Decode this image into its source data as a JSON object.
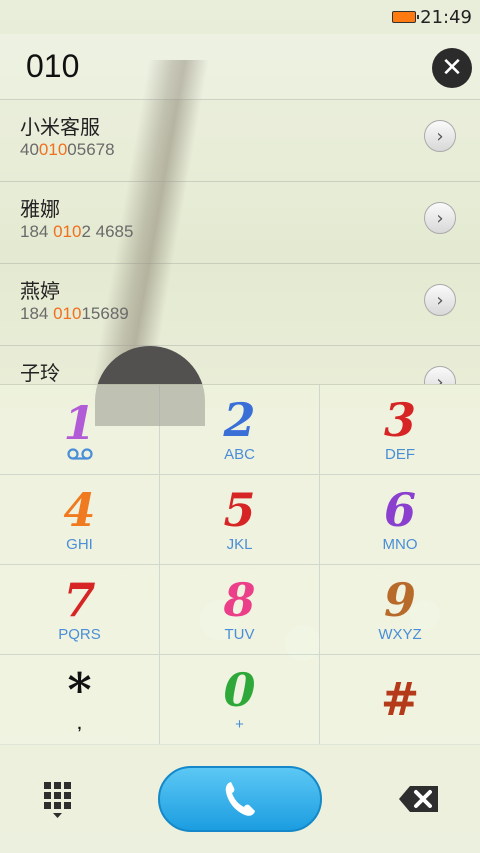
{
  "status_bar": {
    "time": "21:49"
  },
  "dialer": {
    "input": "010"
  },
  "results": [
    {
      "name": "小米客服",
      "number_pre": "40",
      "number_match": "010",
      "number_post": "05678"
    },
    {
      "name": "雅娜",
      "number_pre": "184 ",
      "number_match": "010",
      "number_post": "2 4685"
    },
    {
      "name": "燕婷",
      "number_pre": "184 ",
      "number_match": "010",
      "number_post": "15689"
    },
    {
      "name": "子玲",
      "number_pre": "",
      "number_match": "",
      "number_post": ""
    }
  ],
  "keys": [
    {
      "digit": "1",
      "letters": "",
      "color": "#b25bd6"
    },
    {
      "digit": "2",
      "letters": "ABC",
      "color": "#3a6fd8"
    },
    {
      "digit": "3",
      "letters": "DEF",
      "color": "#d72525"
    },
    {
      "digit": "4",
      "letters": "GHI",
      "color": "#f07a1f"
    },
    {
      "digit": "5",
      "letters": "JKL",
      "color": "#d72525"
    },
    {
      "digit": "6",
      "letters": "MNO",
      "color": "#8a3fcf"
    },
    {
      "digit": "7",
      "letters": "PQRS",
      "color": "#d72525"
    },
    {
      "digit": "8",
      "letters": "TUV",
      "color": "#ec3f89"
    },
    {
      "digit": "9",
      "letters": "WXYZ",
      "color": "#b86a2a"
    },
    {
      "digit": "*",
      "letters": ",",
      "color": "#111111"
    },
    {
      "digit": "0",
      "letters": "+",
      "color": "#2fa83a"
    },
    {
      "digit": "#",
      "letters": "",
      "color": "#b53a1a"
    }
  ],
  "colors": {
    "highlight": "#f07020",
    "letters": "#4a8ed8",
    "call_button": "#1c9de0",
    "battery": "#ff7a10"
  },
  "icons": {
    "voicemail": "voicemail-icon",
    "clear": "clear-icon",
    "call": "phone-icon",
    "dialpad": "dialpad-icon",
    "backspace": "backspace-icon"
  }
}
